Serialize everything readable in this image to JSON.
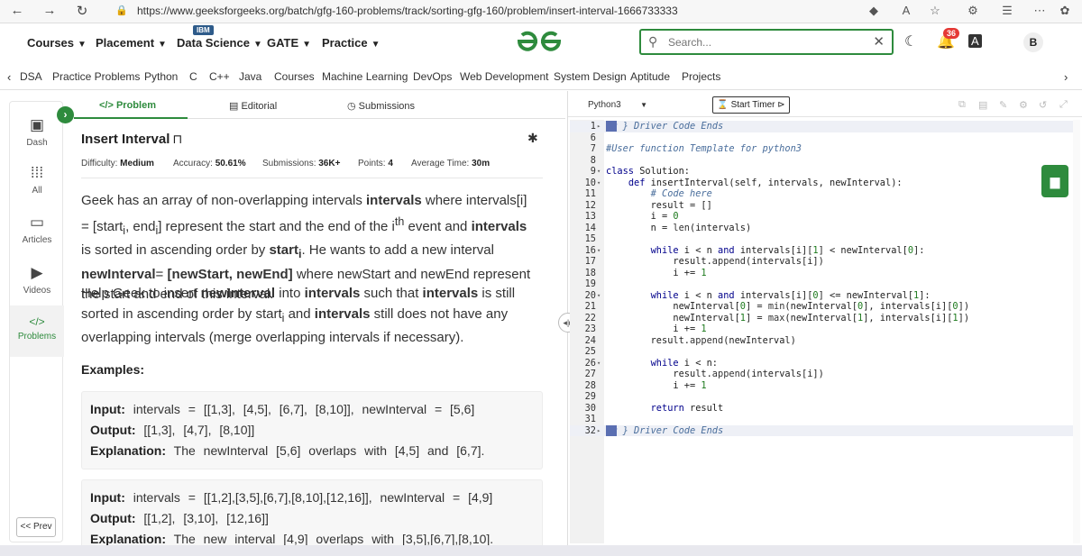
{
  "browser": {
    "url": "https://www.geeksforgeeks.org/batch/gfg-160-problems/track/sorting-gfg-160/problem/insert-interval-1666733333"
  },
  "nav": {
    "menus": [
      "Courses",
      "Placement",
      "Data Science",
      "GATE",
      "Practice"
    ],
    "ibm_badge": "IBM",
    "search_placeholder": "Search...",
    "notif_count": "36",
    "avatar": "B"
  },
  "categories": [
    "DSA",
    "Practice Problems",
    "Python",
    "C",
    "C++",
    "Java",
    "Courses",
    "Machine Learning",
    "DevOps",
    "Web Development",
    "System Design",
    "Aptitude",
    "Projects"
  ],
  "sidebar": {
    "items": [
      "Dash",
      "All",
      "Articles",
      "Videos",
      "Problems"
    ],
    "prev": "<< Prev"
  },
  "tabs": {
    "problem": "Problem",
    "editorial": "Editorial",
    "submissions": "Submissions"
  },
  "problem": {
    "title": "Insert Interval",
    "difficulty_label": "Difficulty:",
    "difficulty": "Medium",
    "accuracy_label": "Accuracy:",
    "accuracy": "50.61%",
    "submissions_label": "Submissions:",
    "submissions": "36K+",
    "points_label": "Points:",
    "points": "4",
    "time_label": "Average Time:",
    "time": "30m",
    "examples_header": "Examples:"
  },
  "examples": [
    {
      "input": "intervals = [[1,3], [4,5], [6,7], [8,10]], newInterval = [5,6]",
      "output": "[[1,3], [4,7], [8,10]]",
      "explanation": "The newInterval [5,6] overlaps with [4,5] and [6,7]."
    },
    {
      "input": "intervals = [[1,2],[3,5],[6,7],[8,10],[12,16]], newInterval = [4,9]",
      "output": "[[1,2], [3,10], [12,16]]",
      "explanation": "The new interval [4,9] overlaps with [3,5],[6,7],[8,10]."
    }
  ],
  "example_labels": {
    "input": "Input:",
    "output": "Output:",
    "explanation": "Explanation:"
  },
  "editor": {
    "language": "Python3",
    "timer": "Start Timer"
  },
  "code_lines": [
    {
      "n": "1",
      "t": "# } Driver Code Ends",
      "fold": true,
      "hl": true
    },
    {
      "n": "6",
      "t": ""
    },
    {
      "n": "7",
      "t": "#User function Template for python3"
    },
    {
      "n": "8",
      "t": ""
    },
    {
      "n": "9",
      "t": "class Solution:",
      "fold": true
    },
    {
      "n": "10",
      "t": "    def insertInterval(self, intervals, newInterval):",
      "fold": true
    },
    {
      "n": "11",
      "t": "        # Code here"
    },
    {
      "n": "12",
      "t": "        result = []"
    },
    {
      "n": "13",
      "t": "        i = 0"
    },
    {
      "n": "14",
      "t": "        n = len(intervals)"
    },
    {
      "n": "15",
      "t": ""
    },
    {
      "n": "16",
      "t": "        while i < n and intervals[i][1] < newInterval[0]:",
      "fold": true
    },
    {
      "n": "17",
      "t": "            result.append(intervals[i])"
    },
    {
      "n": "18",
      "t": "            i += 1"
    },
    {
      "n": "19",
      "t": ""
    },
    {
      "n": "20",
      "t": "        while i < n and intervals[i][0] <= newInterval[1]:",
      "fold": true
    },
    {
      "n": "21",
      "t": "            newInterval[0] = min(newInterval[0], intervals[i][0])"
    },
    {
      "n": "22",
      "t": "            newInterval[1] = max(newInterval[1], intervals[i][1])"
    },
    {
      "n": "23",
      "t": "            i += 1"
    },
    {
      "n": "24",
      "t": "        result.append(newInterval)"
    },
    {
      "n": "25",
      "t": ""
    },
    {
      "n": "26",
      "t": "        while i < n:",
      "fold": true
    },
    {
      "n": "27",
      "t": "            result.append(intervals[i])"
    },
    {
      "n": "28",
      "t": "            i += 1"
    },
    {
      "n": "29",
      "t": ""
    },
    {
      "n": "30",
      "t": "        return result"
    },
    {
      "n": "31",
      "t": ""
    },
    {
      "n": "32",
      "t": "# } Driver Code Ends",
      "fold": true,
      "hl": true
    }
  ],
  "colors": {
    "brand_green": "#2e8b3d",
    "keyword": "#00008b",
    "comment": "#4a6e9c"
  }
}
